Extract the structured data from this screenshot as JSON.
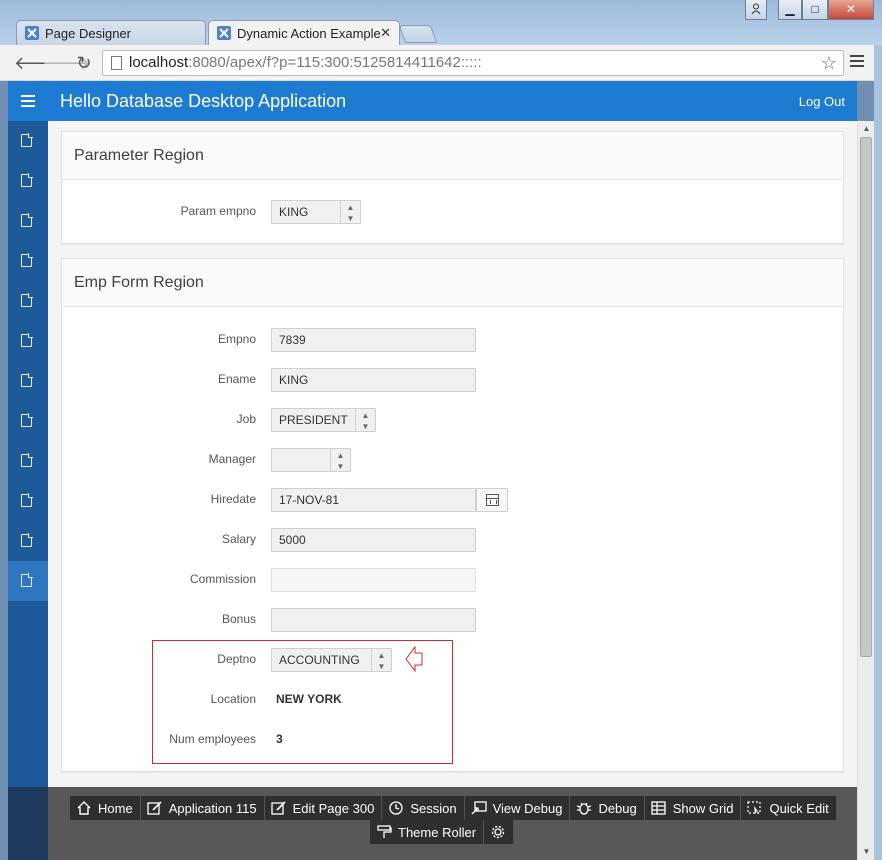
{
  "browser": {
    "tabs": [
      {
        "title": "Page Designer",
        "active": false
      },
      {
        "title": "Dynamic Action Example",
        "active": true
      }
    ],
    "url_host": "localhost",
    "url_rest": ":8080/apex/f?p=115:300:5125814411642:::::"
  },
  "app": {
    "title": "Hello Database Desktop Application",
    "logout_label": "Log Out",
    "accent_color": "#1d7bd2"
  },
  "parameter_region": {
    "title": "Parameter Region",
    "param_empno_label": "Param empno",
    "param_empno_value": "KING"
  },
  "emp_form": {
    "title": "Emp Form Region",
    "empno_label": "Empno",
    "empno_value": "7839",
    "ename_label": "Ename",
    "ename_value": "KING",
    "job_label": "Job",
    "job_value": "PRESIDENT",
    "manager_label": "Manager",
    "manager_value": "",
    "hiredate_label": "Hiredate",
    "hiredate_value": "17-NOV-81",
    "salary_label": "Salary",
    "salary_value": "5000",
    "commission_label": "Commission",
    "commission_value": "",
    "bonus_label": "Bonus",
    "bonus_value": "",
    "deptno_label": "Deptno",
    "deptno_value": "ACCOUNTING",
    "location_label": "Location",
    "location_value": "NEW YORK",
    "num_employees_label": "Num employees",
    "num_employees_value": "3"
  },
  "dev_toolbar": {
    "home": "Home",
    "application": "Application 115",
    "edit_page": "Edit Page 300",
    "session": "Session",
    "view_debug": "View Debug",
    "debug": "Debug",
    "show_grid": "Show Grid",
    "quick_edit": "Quick Edit",
    "theme_roller": "Theme Roller"
  }
}
